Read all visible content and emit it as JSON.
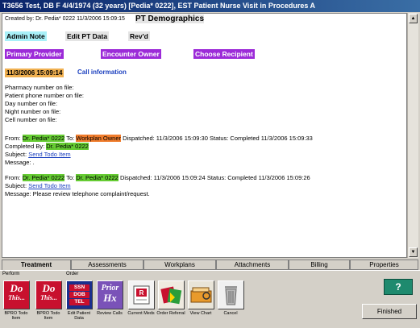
{
  "window": {
    "title": "T3656 Test, DB F 4/4/1974 (32 years) [Pedia* 0222], EST Patient Nurse Visit in Procedures A"
  },
  "document": {
    "created_by": "Created by:  Dr. Pedia* 0222  11/3/2006 15:09:15",
    "title": "PT Demographics",
    "buttons_row1": [
      "Admin Note",
      "Edit PT Data",
      "Rev'd"
    ],
    "buttons_row2": [
      "Primary Provider",
      "Encounter Owner",
      "Choose Recipient"
    ],
    "timestamp": "11/3/2006 15:09:14",
    "call_info_link": "Call information",
    "phone_lines": [
      "Pharmacy number on file:",
      "Patient phone number on file:",
      "Day number on file:",
      "Night number on file:",
      "Cell number on file:"
    ],
    "messages": [
      {
        "from_label": "From:",
        "from": "Dr. Pedia* 0222",
        "to_label": "To:",
        "to": "Workplan Owner",
        "dispatched": "Dispatched: 11/3/2006 15:09:30",
        "status": "Status: Completed  11/3/2006 15:09:33",
        "completed_label": "Completed By:",
        "completed_by": "Dr. Pedia* 0222",
        "subject_label": "Subject:",
        "subject": "Send Todo Item",
        "message": "Message: ."
      },
      {
        "from_label": "From:",
        "from": "Dr. Pedia* 0222",
        "to_label": "To:",
        "to": "Dr. Pedia* 0222",
        "dispatched": "Dispatched: 11/3/2006 15:09:24",
        "status": "Status: Completed  11/3/2006 15:09:26",
        "subject_label": "Subject:",
        "subject": "Send Todo Item",
        "message": "Message: Please review telephone complaint/request."
      }
    ]
  },
  "tabs": [
    "Treatment",
    "Assessments",
    "Workplans",
    "Attachments",
    "Billing",
    "Properties"
  ],
  "toolbar": {
    "group_perform": "Perform",
    "group_order": "Order",
    "buttons": [
      {
        "label": "BPRO Todo Item",
        "icon": "do-this-icon",
        "art": "Do This..."
      },
      {
        "label": "BPRO Todo Item",
        "icon": "do-this-icon",
        "art": "Do This..."
      },
      {
        "label": "Edit Patient Data",
        "icon": "ssn-dob-tel-icon",
        "art": "SSN DOB TEL"
      },
      {
        "label": "Review Calls",
        "icon": "prior-hx-icon",
        "art": "Prior Hx"
      },
      {
        "label": "Current Meds",
        "icon": "rx-icon",
        "art": "Rx"
      },
      {
        "label": "Order Referral",
        "icon": "referral-icon",
        "art": ""
      },
      {
        "label": "View Chart",
        "icon": "chart-icon",
        "art": ""
      },
      {
        "label": "Cancel",
        "icon": "trash-icon",
        "art": ""
      }
    ],
    "help": "?",
    "finished": "Finished"
  }
}
